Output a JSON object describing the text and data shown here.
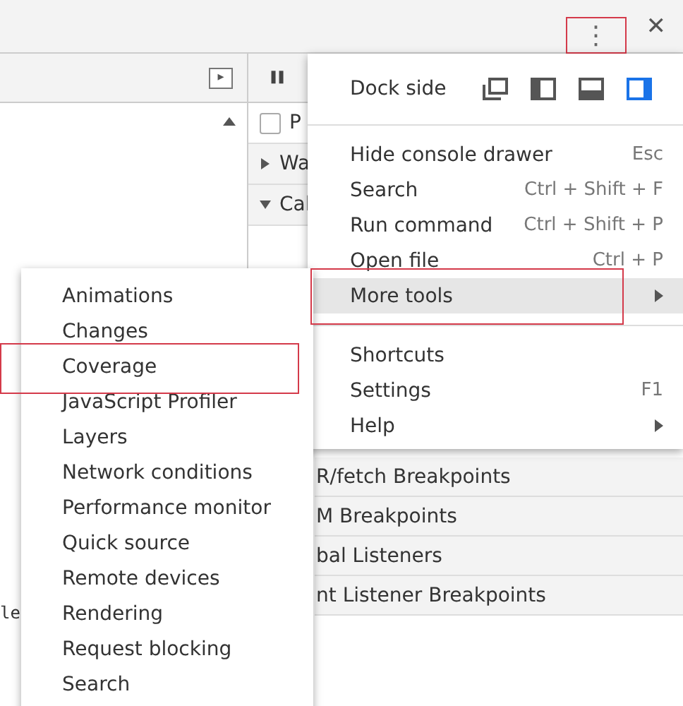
{
  "top_bar": {
    "menu_button": {
      "label": "⋮",
      "annotated": true
    },
    "close_button": {
      "label": "✕"
    }
  },
  "left_panel": {
    "toolbar_icon": "▸",
    "content_text": "le"
  },
  "right_panel": {
    "toolbar_button": "❚❚",
    "sections": [
      {
        "kind": "checkbox",
        "label": "P",
        "checked": false
      },
      {
        "kind": "collapsible",
        "label": "Wa",
        "expanded": false
      },
      {
        "kind": "collapsible",
        "label": "Cal",
        "expanded": true
      }
    ],
    "breakpoint_sections": [
      "R/fetch Breakpoints",
      "M Breakpoints",
      "bal Listeners",
      "nt Listener Breakpoints"
    ]
  },
  "main_menu": {
    "dock_side": {
      "label": "Dock side",
      "options": [
        {
          "kind": "undock",
          "selected": false
        },
        {
          "kind": "left",
          "selected": false
        },
        {
          "kind": "bottom",
          "selected": false
        },
        {
          "kind": "right",
          "selected": true
        }
      ]
    },
    "groups": [
      [
        {
          "label": "Hide console drawer",
          "shortcut": "Esc",
          "selected": false,
          "submenu": false,
          "annotated": false
        },
        {
          "label": "Search",
          "shortcut": "Ctrl + Shift + F",
          "selected": false,
          "submenu": false,
          "annotated": false
        },
        {
          "label": "Run command",
          "shortcut": "Ctrl + Shift + P",
          "selected": false,
          "submenu": false,
          "annotated": false
        },
        {
          "label": "Open file",
          "shortcut": "Ctrl + P",
          "selected": false,
          "submenu": false,
          "annotated": false
        },
        {
          "label": "More tools",
          "selected": true,
          "submenu": true,
          "annotated": true
        }
      ],
      [
        {
          "label": "Shortcuts",
          "selected": false,
          "submenu": false,
          "annotated": false
        },
        {
          "label": "Settings",
          "shortcut": "F1",
          "selected": false,
          "submenu": false,
          "annotated": false
        },
        {
          "label": "Help",
          "selected": false,
          "submenu": true,
          "annotated": false
        }
      ]
    ]
  },
  "more_tools_menu": [
    {
      "label": "Animations",
      "annotated": false
    },
    {
      "label": "Changes",
      "annotated": false
    },
    {
      "label": "Coverage",
      "annotated": true
    },
    {
      "label": "JavaScript Profiler",
      "annotated": false
    },
    {
      "label": "Layers",
      "annotated": false
    },
    {
      "label": "Network conditions",
      "annotated": false
    },
    {
      "label": "Performance monitor",
      "annotated": false
    },
    {
      "label": "Quick source",
      "annotated": false
    },
    {
      "label": "Remote devices",
      "annotated": false
    },
    {
      "label": "Rendering",
      "annotated": false
    },
    {
      "label": "Request blocking",
      "annotated": false
    },
    {
      "label": "Search",
      "annotated": false
    }
  ]
}
